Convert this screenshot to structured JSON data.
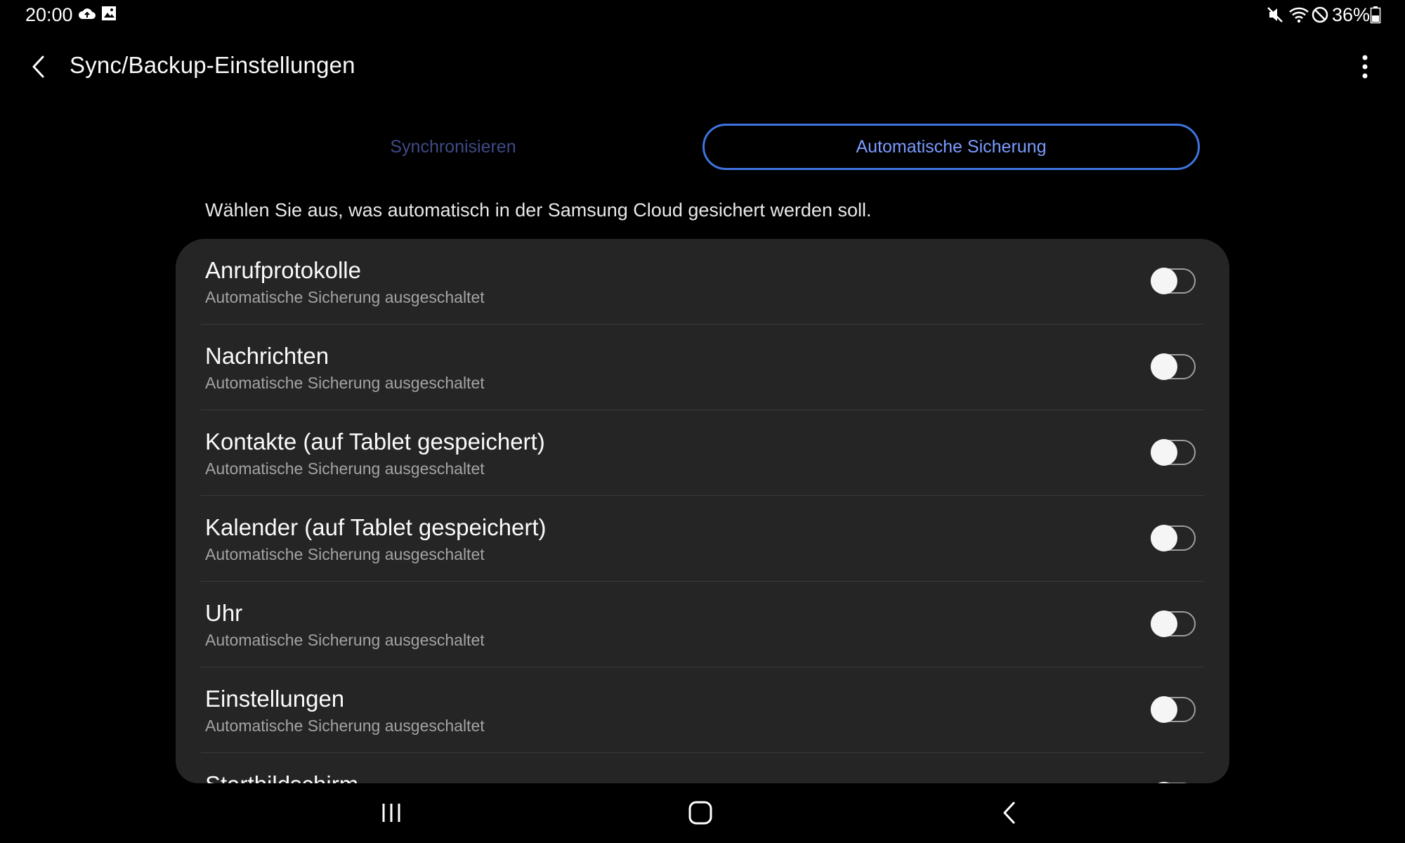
{
  "status_bar": {
    "time": "20:00",
    "battery": "36%",
    "icons": [
      "cloud-sync-icon",
      "image-icon",
      "mute-icon",
      "wifi-icon",
      "do-not-disturb-icon",
      "battery-icon"
    ]
  },
  "app_bar": {
    "title": "Sync/Backup-Einstellungen",
    "back_icon": "back-arrow-icon",
    "more_icon": "more-options-icon"
  },
  "tabs": [
    {
      "label": "Synchronisieren",
      "selected": false
    },
    {
      "label": "Automatische Sicherung",
      "selected": true
    }
  ],
  "description": "Wählen Sie aus, was automatisch in der Samsung Cloud gesichert werden soll.",
  "items": [
    {
      "title": "Anrufprotokolle",
      "subtitle": "Automatische Sicherung ausgeschaltet",
      "enabled": false
    },
    {
      "title": "Nachrichten",
      "subtitle": "Automatische Sicherung ausgeschaltet",
      "enabled": false
    },
    {
      "title": "Kontakte (auf Tablet gespeichert)",
      "subtitle": "Automatische Sicherung ausgeschaltet",
      "enabled": false
    },
    {
      "title": "Kalender (auf Tablet gespeichert)",
      "subtitle": "Automatische Sicherung ausgeschaltet",
      "enabled": false
    },
    {
      "title": "Uhr",
      "subtitle": "Automatische Sicherung ausgeschaltet",
      "enabled": false
    },
    {
      "title": "Einstellungen",
      "subtitle": "Automatische Sicherung ausgeschaltet",
      "enabled": false
    },
    {
      "title": "Startbildschirm",
      "subtitle": "",
      "enabled": false
    }
  ],
  "nav_bar": {
    "icons": [
      "recent-apps-icon",
      "home-icon",
      "back-icon"
    ]
  },
  "colors": {
    "background": "#000000",
    "card": "#252525",
    "accent": "#3e74e0",
    "accent_text": "#7b9bff",
    "inactive_tab": "#3f4a86"
  }
}
